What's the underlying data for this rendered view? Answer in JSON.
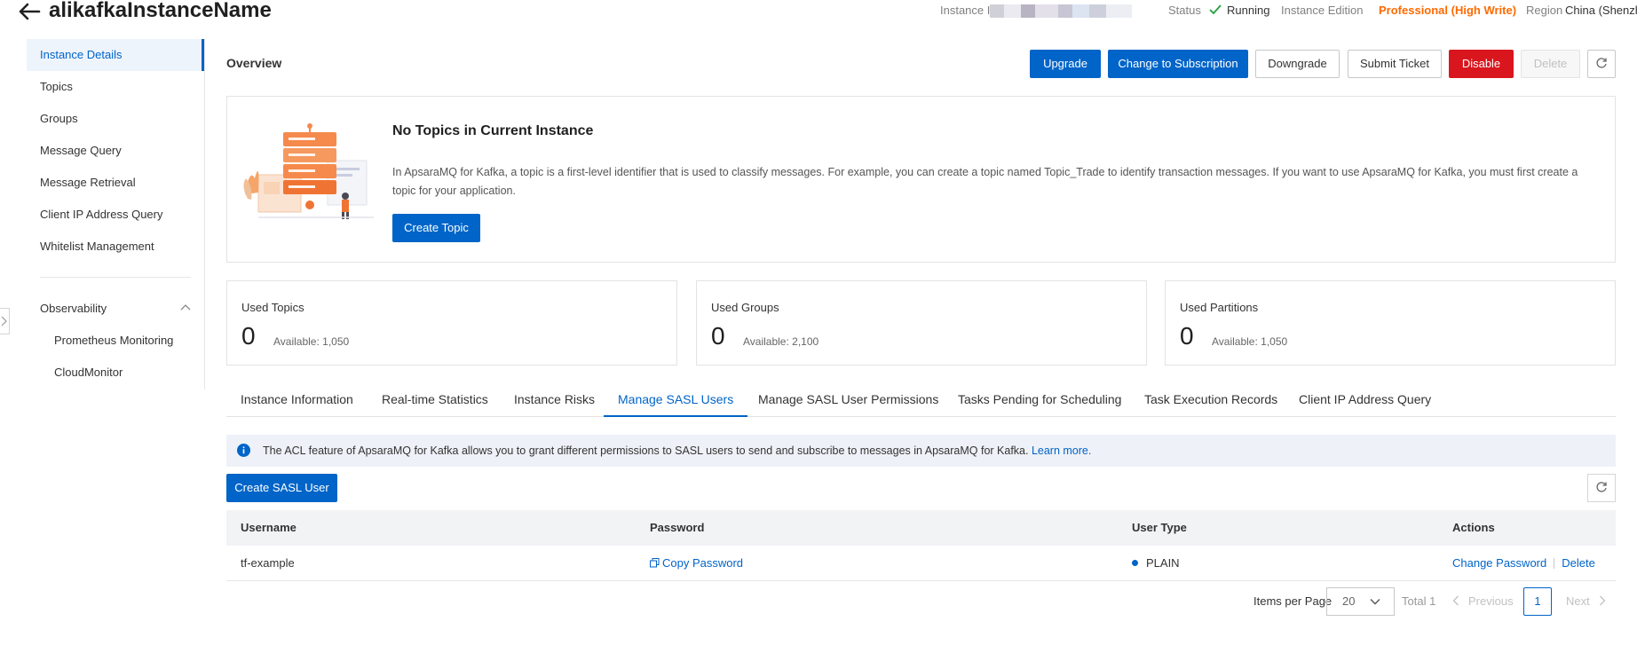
{
  "header": {
    "title": "alikafkaInstanceName",
    "instance_id_label": "Instance ID",
    "status_label": "Status",
    "status_value": "Running",
    "edition_label": "Instance Edition",
    "edition_value": "Professional (High Write)",
    "region_label": "Region",
    "region_value": "China (Shenzhen)"
  },
  "sidebar": {
    "items": [
      {
        "label": "Instance Details"
      },
      {
        "label": "Topics"
      },
      {
        "label": "Groups"
      },
      {
        "label": "Message Query"
      },
      {
        "label": "Message Retrieval"
      },
      {
        "label": "Client IP Address Query"
      },
      {
        "label": "Whitelist Management"
      }
    ],
    "section_label": "Observability",
    "sub_items": [
      {
        "label": "Prometheus Monitoring"
      },
      {
        "label": "CloudMonitor"
      }
    ]
  },
  "overview": {
    "title": "Overview",
    "buttons": {
      "upgrade": "Upgrade",
      "change_subscription": "Change to Subscription",
      "downgrade": "Downgrade",
      "submit_ticket": "Submit Ticket",
      "disable": "Disable",
      "delete": "Delete"
    }
  },
  "empty_state": {
    "title": "No Topics in Current Instance",
    "description": "In ApsaraMQ for Kafka, a topic is a first-level identifier that is used to classify messages. For example, you can create a topic named Topic_Trade to identify transaction messages. If you want to use ApsaraMQ for Kafka, you must first create a topic for your application.",
    "button": "Create Topic"
  },
  "stats": [
    {
      "label": "Used Topics",
      "value": "0",
      "available": "Available: 1,050"
    },
    {
      "label": "Used Groups",
      "value": "0",
      "available": "Available: 2,100"
    },
    {
      "label": "Used Partitions",
      "value": "0",
      "available": "Available: 1,050"
    }
  ],
  "tabs": [
    {
      "label": "Instance Information"
    },
    {
      "label": "Real-time Statistics"
    },
    {
      "label": "Instance Risks"
    },
    {
      "label": "Manage SASL Users"
    },
    {
      "label": "Manage SASL User Permissions"
    },
    {
      "label": "Tasks Pending for Scheduling"
    },
    {
      "label": "Task Execution Records"
    },
    {
      "label": "Client IP Address Query"
    }
  ],
  "banner": {
    "text": "The ACL feature of ApsaraMQ for Kafka allows you to grant different permissions to SASL users to send and subscribe to messages in ApsaraMQ for Kafka. ",
    "link": "Learn more."
  },
  "sasl": {
    "create_button": "Create SASL User",
    "columns": [
      "Username",
      "Password",
      "User Type",
      "Actions"
    ],
    "rows": [
      {
        "username": "tf-example",
        "password_action": "Copy Password",
        "user_type": "PLAIN",
        "action_change": "Change Password",
        "action_delete": "Delete"
      }
    ]
  },
  "pagination": {
    "items_per_page_label": "Items per Page",
    "page_size": "20",
    "total": "Total 1",
    "previous": "Previous",
    "current_page": "1",
    "next": "Next"
  },
  "colors": {
    "primary": "#0064c8",
    "danger": "#d9161e",
    "edition": "#ff6a00",
    "running": "#1e9e3a"
  }
}
